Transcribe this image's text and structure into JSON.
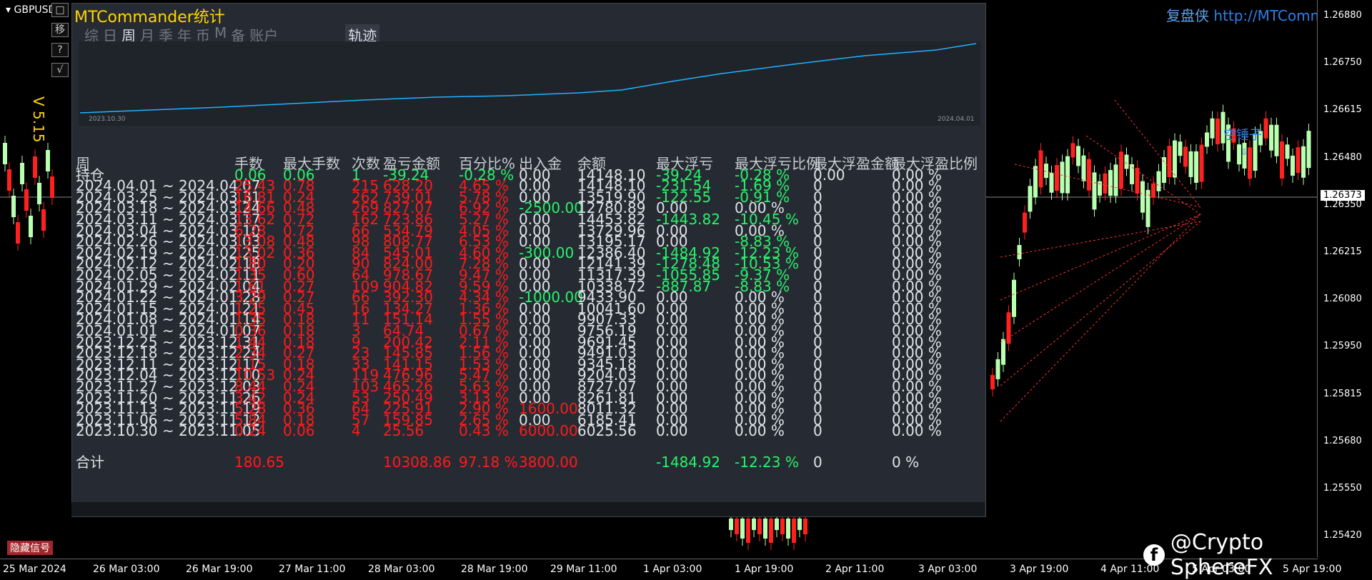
{
  "symbol_tab": "GBPUSD",
  "side_buttons": [
    "□",
    "移",
    "?",
    "√"
  ],
  "version": "V 5.15",
  "panel": {
    "title": "MTCommander统计",
    "tabs": [
      "综",
      "日",
      "周",
      "月",
      "季",
      "年",
      "币",
      "M",
      "备",
      "账户"
    ],
    "active_tab": "周",
    "track_tab": "轨迹",
    "equity_start_date": "2023.10.30",
    "equity_end_date": "2024.04.01"
  },
  "table": {
    "headers": [
      "周",
      "手数",
      "最大手数",
      "次数",
      "盈亏金额",
      "百分比%",
      "出入金",
      "余额",
      "最大浮亏",
      "最大浮亏比例",
      "最大浮盈金额",
      "最大浮盈比例"
    ],
    "rows": [
      {
        "period": "持仓",
        "lots": "0.06",
        "max_lots": "0.06",
        "count": "1",
        "pnl": "-39.24",
        "pct": "-0.28 %",
        "io": "0.00",
        "balance": "14148.10",
        "max_float_loss": "-39.24",
        "max_float_loss_pct": "-0.28 %",
        "max_float_profit": "0.00",
        "max_float_profit_pct": "0.00 %"
      },
      {
        "period": "2024.04.01 ~ 2024.04.07",
        "lots": "25.43",
        "max_lots": "0.78",
        "count": "215",
        "pnl": "628.20",
        "pct": "4.65 %",
        "io": "0.00",
        "balance": "14148.10",
        "max_float_loss": "-231.54",
        "max_float_loss_pct": "-1.69 %",
        "max_float_profit": "0",
        "max_float_profit_pct": "0.00 %"
      },
      {
        "period": "2024.03.25 ~ 2024.03.31",
        "lots": "16.81",
        "max_lots": "0.24",
        "count": "262",
        "pnl": "739.01",
        "pct": "5.78 %",
        "io": "0.00",
        "balance": "13519.90",
        "max_float_loss": "-122.55",
        "max_float_loss_pct": "-0.91 %",
        "max_float_profit": "0",
        "max_float_profit_pct": "0.00 %"
      },
      {
        "period": "2024.03.18 ~ 2024.03.24",
        "lots": "14.66",
        "max_lots": "0.48",
        "count": "269",
        "pnl": "827.07",
        "pct": "6.92 %",
        "io": "-2500.00",
        "balance": "12780.89",
        "max_float_loss": "0.00",
        "max_float_loss_pct": "0.00 %",
        "max_float_profit": "0",
        "max_float_profit_pct": "0.00 %"
      },
      {
        "period": "2024.03.11 ~ 2024.03.17",
        "lots": "13.62",
        "max_lots": "0.72",
        "count": "162",
        "pnl": "723.86",
        "pct": "5.27 %",
        "io": "0.00",
        "balance": "14453.82",
        "max_float_loss": "-1443.82",
        "max_float_loss_pct": "-10.45 %",
        "max_float_profit": "0",
        "max_float_profit_pct": "0.00 %"
      },
      {
        "period": "2024.03.04 ~ 2024.03.10",
        "lots": "6.28",
        "max_lots": "0.72",
        "count": "66",
        "pnl": "534.79",
        "pct": "4.05 %",
        "io": "0.00",
        "balance": "13729.96",
        "max_float_loss": "0.00",
        "max_float_loss_pct": "0.00 %",
        "max_float_profit": "0",
        "max_float_profit_pct": "0.00 %"
      },
      {
        "period": "2024.02.26 ~ 2024.03.03",
        "lots": "13.08",
        "max_lots": "0.48",
        "count": "98",
        "pnl": "808.77",
        "pct": "6.53 %",
        "io": "0.00",
        "balance": "13195.17",
        "max_float_loss": "0.00",
        "max_float_loss_pct": "-8.83 %",
        "max_float_profit": "0",
        "max_float_profit_pct": "0.00 %"
      },
      {
        "period": "2024.02.19 ~ 2024.02.25",
        "lots": "13.02",
        "max_lots": "0.36",
        "count": "84",
        "pnl": "545.01",
        "pct": "4.60 %",
        "io": "-300.00",
        "balance": "12386.40",
        "max_float_loss": "-1484.92",
        "max_float_loss_pct": "-12.23 %",
        "max_float_profit": "0",
        "max_float_profit_pct": "0.00 %"
      },
      {
        "period": "2024.02.12 ~ 2024.02.18",
        "lots": "1.80",
        "max_lots": "0.20",
        "count": "90",
        "pnl": "824.00",
        "pct": "7.28 %",
        "io": "0.00",
        "balance": "12141.39",
        "max_float_loss": "-1278.48",
        "max_float_loss_pct": "-10.53 %",
        "max_float_profit": "0",
        "max_float_profit_pct": "0.00 %"
      },
      {
        "period": "2024.02.05 ~ 2024.02.11",
        "lots": "1.35",
        "max_lots": "0.60",
        "count": "64",
        "pnl": "978.67",
        "pct": "9.47 %",
        "io": "0.00",
        "balance": "11317.39",
        "max_float_loss": "-1055.85",
        "max_float_loss_pct": "-9.37 %",
        "max_float_profit": "0",
        "max_float_profit_pct": "0.00 %"
      },
      {
        "period": "2024.01.29 ~ 2024.02.04",
        "lots": "1.61",
        "max_lots": "0.27",
        "count": "109",
        "pnl": "904.82",
        "pct": "9.59 %",
        "io": "0.00",
        "balance": "10338.72",
        "max_float_loss": "-887.87",
        "max_float_loss_pct": "-8.83 %",
        "max_float_profit": "0",
        "max_float_profit_pct": "0.00 %"
      },
      {
        "period": "2024.01.22 ~ 2024.01.28",
        "lots": "3.29",
        "max_lots": "0.27",
        "count": "66",
        "pnl": "392.30",
        "pct": "4.34 %",
        "io": "-1000.00",
        "balance": "9433.90",
        "max_float_loss": "0.00",
        "max_float_loss_pct": "0.00 %",
        "max_float_profit": "0",
        "max_float_profit_pct": "0.00 %"
      },
      {
        "period": "2024.01.15 ~ 2024.01.21",
        "lots": "1.25",
        "max_lots": "0.45",
        "count": "16",
        "pnl": "134.27",
        "pct": "1.36 %",
        "io": "0.00",
        "balance": "10041.60",
        "max_float_loss": "0.00",
        "max_float_loss_pct": "0.00 %",
        "max_float_profit": "0",
        "max_float_profit_pct": "0.00 %"
      },
      {
        "period": "2024.01.08 ~ 2024.01.14",
        "lots": "1.35",
        "max_lots": "0.18",
        "count": "11",
        "pnl": "151.14",
        "pct": "1.55 %",
        "io": "0.00",
        "balance": "9907.33",
        "max_float_loss": "0.00",
        "max_float_loss_pct": "0.00 %",
        "max_float_profit": "0",
        "max_float_profit_pct": "0.00 %"
      },
      {
        "period": "2024.01.01 ~ 2024.01.07",
        "lots": "0.36",
        "max_lots": "0.18",
        "count": "3",
        "pnl": "64.74",
        "pct": "0.67 %",
        "io": "0.00",
        "balance": "9756.19",
        "max_float_loss": "0.00",
        "max_float_loss_pct": "0.00 %",
        "max_float_profit": "0",
        "max_float_profit_pct": "0.00 %"
      },
      {
        "period": "2023.12.25 ~ 2023.12.31",
        "lots": "1.44",
        "max_lots": "0.18",
        "count": "9",
        "pnl": "200.42",
        "pct": "2.11 %",
        "io": "0.00",
        "balance": "9691.45",
        "max_float_loss": "0.00",
        "max_float_loss_pct": "0.00 %",
        "max_float_profit": "0",
        "max_float_profit_pct": "0.00 %"
      },
      {
        "period": "2023.12.18 ~ 2023.12.24",
        "lots": "2.34",
        "max_lots": "0.27",
        "count": "23",
        "pnl": "145.85",
        "pct": "1.56 %",
        "io": "0.00",
        "balance": "9491.03",
        "max_float_loss": "0.00",
        "max_float_loss_pct": "0.00 %",
        "max_float_profit": "0",
        "max_float_profit_pct": "0.00 %"
      },
      {
        "period": "2023.12.11 ~ 2023.12.17",
        "lots": "1.15",
        "max_lots": "0.18",
        "count": "33",
        "pnl": "141.15",
        "pct": "1.53 %",
        "io": "0.00",
        "balance": "9345.18",
        "max_float_loss": "0.00",
        "max_float_loss_pct": "0.00 %",
        "max_float_profit": "0",
        "max_float_profit_pct": "0.00 %"
      },
      {
        "period": "2023.12.04 ~ 2023.12.10",
        "lots": "10.53",
        "max_lots": "0.24",
        "count": "119",
        "pnl": "476.96",
        "pct": "5.47 %",
        "io": "0.00",
        "balance": "9204.03",
        "max_float_loss": "0.00",
        "max_float_loss_pct": "0.00 %",
        "max_float_profit": "0",
        "max_float_profit_pct": "0.00 %"
      },
      {
        "period": "2023.11.27 ~ 2023.12.03",
        "lots": "8.44",
        "max_lots": "0.24",
        "count": "103",
        "pnl": "465.26",
        "pct": "5.63 %",
        "io": "0.00",
        "balance": "8727.07",
        "max_float_loss": "0.00",
        "max_float_loss_pct": "0.00 %",
        "max_float_profit": "0",
        "max_float_profit_pct": "0.00 %"
      },
      {
        "period": "2023.11.20 ~ 2023.11.26",
        "lots": "3.42",
        "max_lots": "0.24",
        "count": "53",
        "pnl": "250.49",
        "pct": "3.13 %",
        "io": "0.00",
        "balance": "8261.81",
        "max_float_loss": "0.00",
        "max_float_loss_pct": "0.00 %",
        "max_float_profit": "0",
        "max_float_profit_pct": "0.00 %"
      },
      {
        "period": "2023.11.13 ~ 2023.11.19",
        "lots": "5.28",
        "max_lots": "0.36",
        "count": "64",
        "pnl": "225.91",
        "pct": "2.90 %",
        "io": "1600.00",
        "balance": "8011.32",
        "max_float_loss": "0.00",
        "max_float_loss_pct": "0.00 %",
        "max_float_profit": "0",
        "max_float_profit_pct": "0.00 %"
      },
      {
        "period": "2023.11.06 ~ 2023.11.12",
        "lots": "5.84",
        "max_lots": "0.18",
        "count": "57",
        "pnl": "159.85",
        "pct": "2.65 %",
        "io": "0.00",
        "balance": "6185.41",
        "max_float_loss": "0.00",
        "max_float_loss_pct": "0.00 %",
        "max_float_profit": "0",
        "max_float_profit_pct": "0.00 %"
      },
      {
        "period": "2023.10.30 ~ 2023.11.05",
        "lots": "0.24",
        "max_lots": "0.06",
        "count": "4",
        "pnl": "25.56",
        "pct": "0.43 %",
        "io": "6000.00",
        "balance": "6025.56",
        "max_float_loss": "0.00",
        "max_float_loss_pct": "0.00 %",
        "max_float_profit": "0",
        "max_float_profit_pct": "0.00 %"
      }
    ],
    "total": {
      "label": "合计",
      "lots": "180.65",
      "pnl": "10308.86",
      "pct": "97.18 %",
      "io": "3800.00",
      "max_float_loss": "-1484.92",
      "max_float_loss_pct": "-12.23 %",
      "max_float_profit": "0",
      "max_float_profit_pct": "0 %"
    }
  },
  "price_axis": {
    "ticks": [
      "1.26880",
      "1.26750",
      "1.26615",
      "1.26480",
      "1.26350",
      "1.26215",
      "1.26080",
      "1.25950",
      "1.25815",
      "1.25680",
      "1.25550",
      "1.25420"
    ],
    "current": "1.26373"
  },
  "time_axis": [
    "25 Mar 2024",
    "26 Mar 03:00",
    "26 Mar 19:00",
    "27 Mar 11:00",
    "28 Mar 03:00",
    "28 Mar 19:00",
    "29 Mar 11:00",
    "1 Apr 03:00",
    "1 Apr 19:00",
    "2 Apr 11:00",
    "3 Apr 03:00",
    "3 Apr 19:00",
    "4 Apr 11:00",
    "5 Apr 03:00",
    "5 Apr 19:00"
  ],
  "brand": {
    "cn": "复盘侠",
    "url": "http://MTComm"
  },
  "annotation": "空锤子",
  "watermark": "@Crypto SphereFX",
  "hide_signal": "隐藏信号",
  "colors": {
    "loss": "#ff1a1a",
    "profit": "#29f26a",
    "equity_line": "#1fb4ff",
    "brand": "#2f7ee8",
    "title": "#ffd400"
  }
}
